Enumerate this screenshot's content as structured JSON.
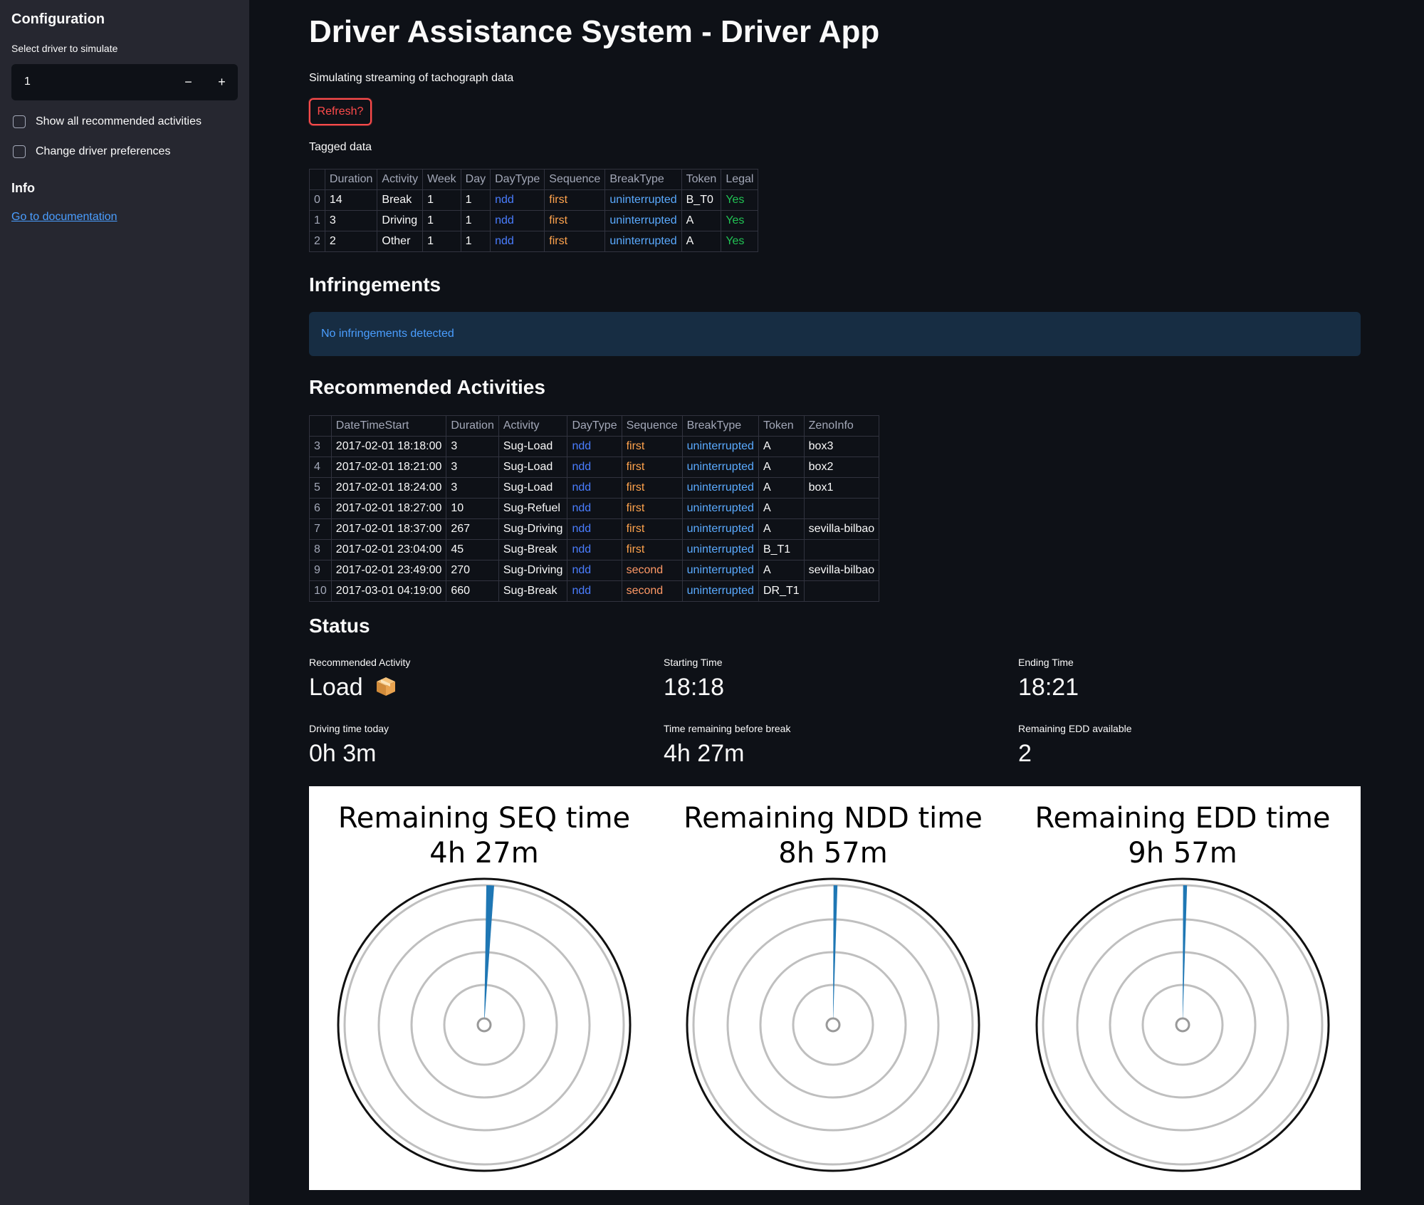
{
  "sidebar": {
    "configuration_heading": "Configuration",
    "driver_select_label": "Select driver to simulate",
    "driver_value": "1",
    "decrement_label": "−",
    "increment_label": "+",
    "show_all_label": "Show all recommended activities",
    "show_all_checked": false,
    "change_prefs_label": "Change driver preferences",
    "change_prefs_checked": false,
    "info_heading": "Info",
    "documentation_link": "Go to documentation"
  },
  "main": {
    "title": "Driver Assistance System - Driver App",
    "subtitle": "Simulating streaming of tachograph data",
    "refresh_label": "Refresh?",
    "tagged_label": "Tagged data",
    "infringements_heading": "Infringements",
    "infringements_message": "No infringements detected",
    "recommended_heading": "Recommended Activities",
    "status_heading": "Status"
  },
  "tagged_table": {
    "columns": [
      "",
      "Duration",
      "Activity",
      "Week",
      "Day",
      "DayType",
      "Sequence",
      "BreakType",
      "Token",
      "Legal"
    ],
    "rows": [
      [
        "0",
        "14",
        "Break",
        "1",
        "1",
        "ndd",
        "first",
        "uninterrupted",
        "B_T0",
        "Yes"
      ],
      [
        "1",
        "3",
        "Driving",
        "1",
        "1",
        "ndd",
        "first",
        "uninterrupted",
        "A",
        "Yes"
      ],
      [
        "2",
        "2",
        "Other",
        "1",
        "1",
        "ndd",
        "first",
        "uninterrupted",
        "A",
        "Yes"
      ]
    ]
  },
  "recommended_table": {
    "columns": [
      "",
      "DateTimeStart",
      "Duration",
      "Activity",
      "DayType",
      "Sequence",
      "BreakType",
      "Token",
      "ZenoInfo"
    ],
    "rows": [
      [
        "3",
        "2017-02-01 18:18:00",
        "3",
        "Sug-Load",
        "ndd",
        "first",
        "uninterrupted",
        "A",
        "box3"
      ],
      [
        "4",
        "2017-02-01 18:21:00",
        "3",
        "Sug-Load",
        "ndd",
        "first",
        "uninterrupted",
        "A",
        "box2"
      ],
      [
        "5",
        "2017-02-01 18:24:00",
        "3",
        "Sug-Load",
        "ndd",
        "first",
        "uninterrupted",
        "A",
        "box1"
      ],
      [
        "6",
        "2017-02-01 18:27:00",
        "10",
        "Sug-Refuel",
        "ndd",
        "first",
        "uninterrupted",
        "A",
        ""
      ],
      [
        "7",
        "2017-02-01 18:37:00",
        "267",
        "Sug-Driving",
        "ndd",
        "first",
        "uninterrupted",
        "A",
        "sevilla-bilbao"
      ],
      [
        "8",
        "2017-02-01 23:04:00",
        "45",
        "Sug-Break",
        "ndd",
        "first",
        "uninterrupted",
        "B_T1",
        ""
      ],
      [
        "9",
        "2017-02-01 23:49:00",
        "270",
        "Sug-Driving",
        "ndd",
        "second",
        "uninterrupted",
        "A",
        "sevilla-bilbao"
      ],
      [
        "10",
        "2017-03-01 04:19:00",
        "660",
        "Sug-Break",
        "ndd",
        "second",
        "uninterrupted",
        "DR_T1",
        ""
      ]
    ]
  },
  "status": {
    "recommended_activity_label": "Recommended Activity",
    "recommended_activity_value": "Load",
    "recommended_activity_icon": "package-icon",
    "starting_time_label": "Starting Time",
    "starting_time_value": "18:18",
    "ending_time_label": "Ending Time",
    "ending_time_value": "18:21",
    "driving_today_label": "Driving time today",
    "driving_today_value": "0h 3m",
    "time_before_break_label": "Time remaining before break",
    "time_before_break_value": "4h 27m",
    "edd_available_label": "Remaining EDD available",
    "edd_available_value": "2"
  },
  "colors": {
    "background": "#0e1117",
    "sidebar": "#262730",
    "accent_red": "#ff4b4b",
    "info_blue": "#4a9eff",
    "gauge_blue": "#1f77b4",
    "ndd_blue": "#4a7dff",
    "first_orange": "#ffa34d",
    "legal_green": "#21c354"
  },
  "chart_data": [
    {
      "type": "polar-gauge",
      "title_line1": "Remaining SEQ time",
      "title_line2": "4h 27m",
      "wedge_angle_deg": 2.5,
      "wedge_half_width_deg": 1.6,
      "wedge_color": "#1f77b4"
    },
    {
      "type": "polar-gauge",
      "title_line1": "Remaining NDD time",
      "title_line2": "8h 57m",
      "wedge_angle_deg": 1.0,
      "wedge_half_width_deg": 0.8,
      "wedge_color": "#1f77b4"
    },
    {
      "type": "polar-gauge",
      "title_line1": "Remaining EDD time",
      "title_line2": "9h 57m",
      "wedge_angle_deg": 1.0,
      "wedge_half_width_deg": 0.8,
      "wedge_color": "#1f77b4"
    }
  ]
}
